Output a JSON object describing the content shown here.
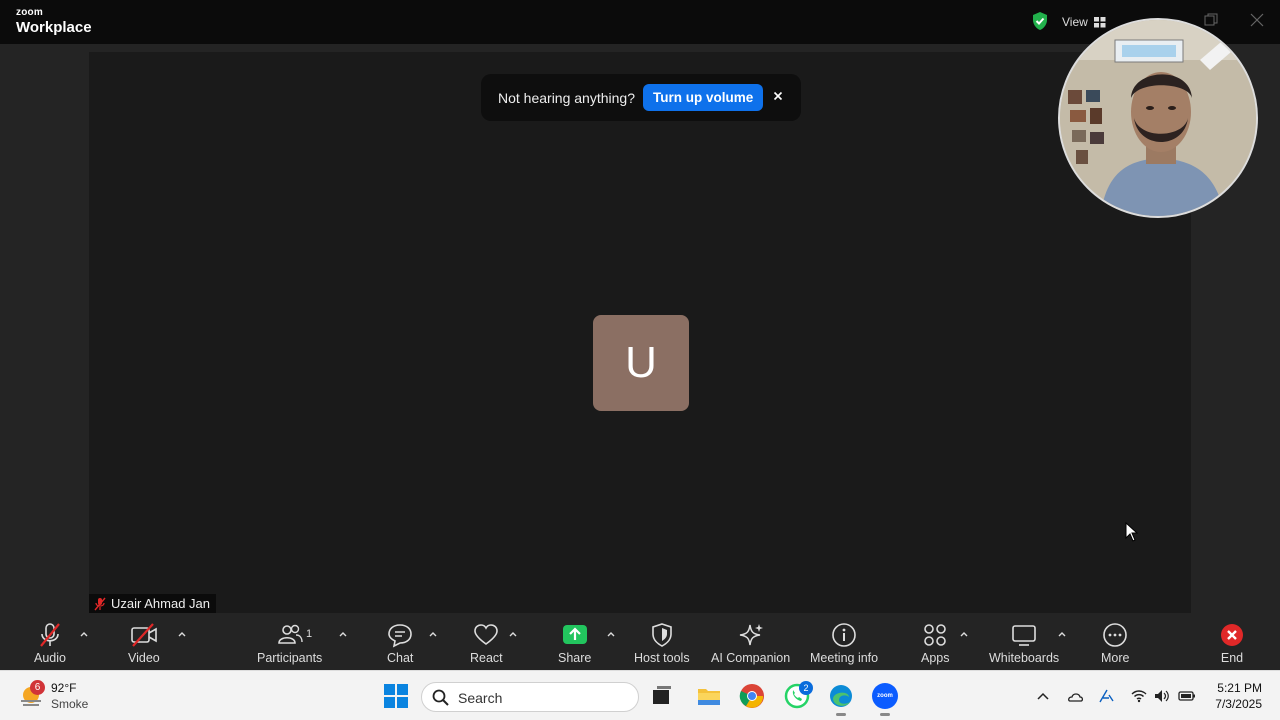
{
  "app": {
    "brand_top": "zoom",
    "brand_bottom": "Workplace",
    "view_label": "View"
  },
  "toast": {
    "message": "Not hearing anything?",
    "action_label": "Turn up volume"
  },
  "participant": {
    "avatar_initial": "U",
    "name": "Uzair Ahmad Jan"
  },
  "toolbar": {
    "audio": "Audio",
    "video": "Video",
    "participants": "Participants",
    "participants_count": "1",
    "chat": "Chat",
    "react": "React",
    "share": "Share",
    "host_tools": "Host tools",
    "ai_companion": "AI Companion",
    "meeting_info": "Meeting info",
    "apps": "Apps",
    "whiteboards": "Whiteboards",
    "more": "More",
    "end": "End"
  },
  "colors": {
    "accent_blue": "#0e71eb",
    "end_red": "#e02828",
    "share_green": "#22c55e",
    "avatar_bg": "#8b6f63"
  },
  "taskbar": {
    "weather_temp": "92°F",
    "weather_desc": "Smoke",
    "weather_badge": "6",
    "search_placeholder": "Search",
    "whatsapp_badge": "2",
    "zoom_icon_text": "zoom",
    "time": "5:21 PM",
    "date": "7/3/2025"
  }
}
